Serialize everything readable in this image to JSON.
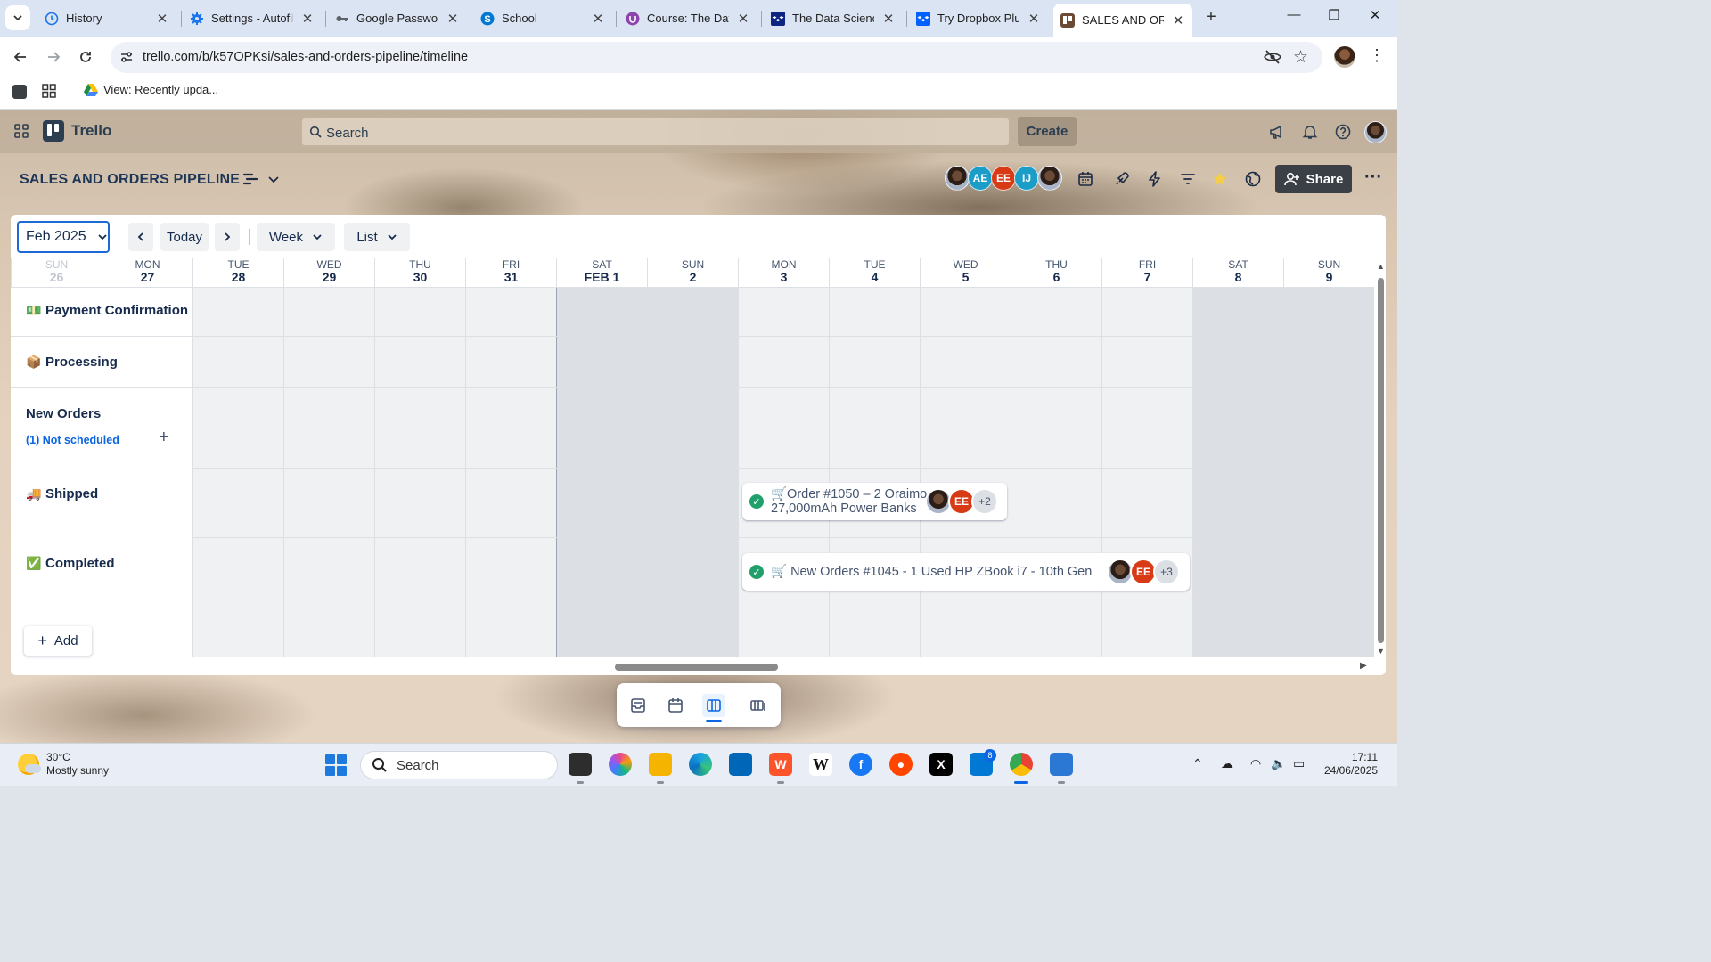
{
  "browser": {
    "tabs": [
      {
        "label": "History",
        "icon": "history-icon"
      },
      {
        "label": "Settings - Autofill",
        "icon": "settings-gear-icon"
      },
      {
        "label": "Google Passwords",
        "icon": "key-icon"
      },
      {
        "label": "School",
        "icon": "skype-icon"
      },
      {
        "label": "Course: The Data",
        "icon": "course-icon"
      },
      {
        "label": "The Data Science",
        "icon": "dropbox-icon"
      },
      {
        "label": "Try Dropbox Plus",
        "icon": "dropbox-icon"
      },
      {
        "label": "SALES AND ORDERS",
        "icon": "trello-tab-icon"
      }
    ],
    "url": "trello.com/b/k57OPKsi/sales-and-orders-pipeline/timeline",
    "bookmark_label": "View: Recently upda..."
  },
  "trello": {
    "brand": "Trello",
    "search_placeholder": "Search",
    "create_label": "Create",
    "board_title": "SALES AND ORDERS PIPELINE",
    "members": [
      {
        "initials": "",
        "color": "photo"
      },
      {
        "initials": "AE",
        "color": "#1b9dc7"
      },
      {
        "initials": "EE",
        "color": "#d83a16"
      },
      {
        "initials": "IJ",
        "color": "#1b9dc7"
      },
      {
        "initials": "",
        "color": "photo"
      }
    ],
    "share_label": "Share"
  },
  "timeline": {
    "month": "Feb 2025",
    "today_label": "Today",
    "range_label": "Week",
    "group_label": "List",
    "days": [
      {
        "dow": "SUN",
        "num": "26",
        "faded": true,
        "weekend": true
      },
      {
        "dow": "MON",
        "num": "27",
        "faded": false,
        "weekend": false
      },
      {
        "dow": "TUE",
        "num": "28",
        "faded": false,
        "weekend": false
      },
      {
        "dow": "WED",
        "num": "29",
        "faded": false,
        "weekend": false
      },
      {
        "dow": "THU",
        "num": "30",
        "faded": false,
        "weekend": false
      },
      {
        "dow": "FRI",
        "num": "31",
        "faded": false,
        "weekend": false
      },
      {
        "dow": "SAT",
        "num": "FEB 1",
        "faded": false,
        "weekend": true
      },
      {
        "dow": "SUN",
        "num": "2",
        "faded": false,
        "weekend": true
      },
      {
        "dow": "MON",
        "num": "3",
        "faded": false,
        "weekend": false
      },
      {
        "dow": "TUE",
        "num": "4",
        "faded": false,
        "weekend": false
      },
      {
        "dow": "WED",
        "num": "5",
        "faded": false,
        "weekend": false
      },
      {
        "dow": "THU",
        "num": "6",
        "faded": false,
        "weekend": false
      },
      {
        "dow": "FRI",
        "num": "7",
        "faded": false,
        "weekend": false
      },
      {
        "dow": "SAT",
        "num": "8",
        "faded": false,
        "weekend": true
      },
      {
        "dow": "SUN",
        "num": "9",
        "faded": false,
        "weekend": true
      }
    ],
    "lanes": [
      {
        "emoji": "💵",
        "name": "Payment Confirmation"
      },
      {
        "emoji": "📦",
        "name": "Processing"
      },
      {
        "emoji": "",
        "name": "New Orders",
        "unscheduled": "(1) Not scheduled"
      },
      {
        "emoji": "🚚",
        "name": "Shipped"
      },
      {
        "emoji": "✅",
        "name": "Completed"
      }
    ],
    "add_label": "Add",
    "cards": [
      {
        "title_line1": "🛒Order #1050 – 2 Oraimo",
        "title_line2": "27,000mAh Power Banks",
        "avatar_badge": "EE",
        "extra": "+2"
      },
      {
        "title_line1": "🛒 New Orders #1045 - 1 Used HP ZBook i7 - 10th Gen",
        "title_line2": "",
        "avatar_badge": "EE",
        "extra": "+3"
      }
    ]
  },
  "taskbar": {
    "temp": "30°C",
    "condition": "Mostly sunny",
    "search_label": "Search",
    "badge_count": "8",
    "time": "17:11",
    "date": "24/06/2025"
  }
}
